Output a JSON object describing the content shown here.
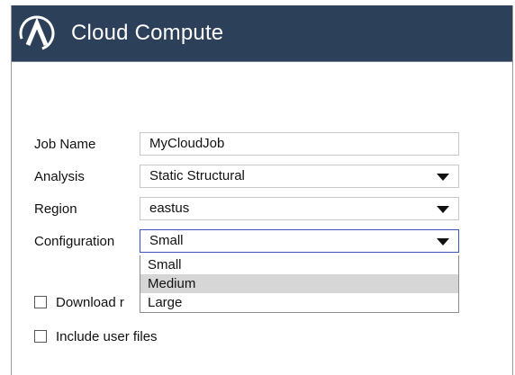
{
  "window": {
    "title": "Cloud Compute",
    "logo": "ansys-logo-icon"
  },
  "form": {
    "job_name": {
      "label": "Job Name",
      "value": "MyCloudJob"
    },
    "analysis": {
      "label": "Analysis",
      "value": "Static Structural"
    },
    "region": {
      "label": "Region",
      "value": "eastus"
    },
    "configuration": {
      "label": "Configuration",
      "value": "Small",
      "options": [
        "Small",
        "Medium",
        "Large"
      ],
      "hovered": "Medium"
    }
  },
  "checkboxes": [
    {
      "label": "Download r",
      "checked": false
    },
    {
      "label": "Include user files",
      "checked": false
    }
  ],
  "colors": {
    "titlebar": "#2c4059",
    "focus_border": "#3b54b8",
    "hover": "#d6d6d6"
  }
}
